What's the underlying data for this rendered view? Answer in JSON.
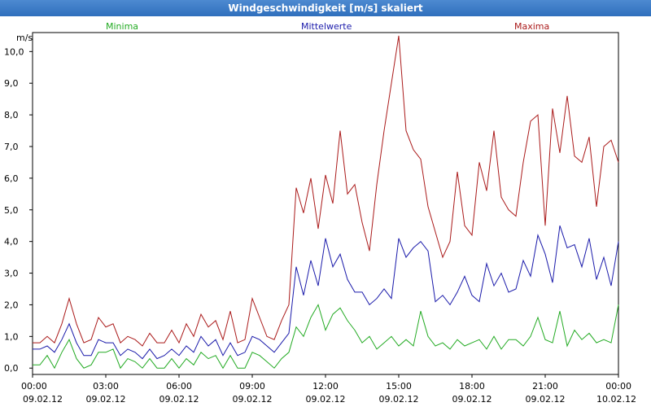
{
  "window": {
    "title": "Windgeschwindigkeit [m/s] skaliert"
  },
  "colors": {
    "minima": "#22aa22",
    "mittelwerte": "#1a1aaa",
    "maxima": "#aa1a1a",
    "grid": "#000000"
  },
  "chart_data": {
    "type": "line",
    "title": "Windgeschwindigkeit [m/s] skaliert",
    "ylabel": "m/s",
    "ylim": [
      -0.2,
      10.6
    ],
    "xlim": [
      0,
      24
    ],
    "grid": true,
    "legend": "top",
    "y_ticks": [
      "0,0",
      "1,0",
      "2,0",
      "3,0",
      "4,0",
      "5,0",
      "6,0",
      "7,0",
      "8,0",
      "9,0",
      "10,0"
    ],
    "x_ticks": [
      {
        "time": "00:00",
        "date": "09.02.12"
      },
      {
        "time": "03:00",
        "date": "09.02.12"
      },
      {
        "time": "06:00",
        "date": "09.02.12"
      },
      {
        "time": "09:00",
        "date": "09.02.12"
      },
      {
        "time": "12:00",
        "date": "09.02.12"
      },
      {
        "time": "15:00",
        "date": "09.02.12"
      },
      {
        "time": "18:00",
        "date": "09.02.12"
      },
      {
        "time": "21:00",
        "date": "09.02.12"
      },
      {
        "time": "00:00",
        "date": "10.02.12"
      }
    ],
    "series": [
      {
        "name": "Minima",
        "x": [
          0,
          0.3,
          0.6,
          0.9,
          1.2,
          1.5,
          1.8,
          2.1,
          2.4,
          2.7,
          3.0,
          3.3,
          3.6,
          3.9,
          4.2,
          4.5,
          4.8,
          5.1,
          5.4,
          5.7,
          6.0,
          6.3,
          6.6,
          6.9,
          7.2,
          7.5,
          7.8,
          8.1,
          8.4,
          8.7,
          9.0,
          9.3,
          9.6,
          9.9,
          10.2,
          10.5,
          10.8,
          11.1,
          11.4,
          11.7,
          12.0,
          12.3,
          12.6,
          12.9,
          13.2,
          13.5,
          13.8,
          14.1,
          14.4,
          14.7,
          15.0,
          15.3,
          15.6,
          15.9,
          16.2,
          16.5,
          16.8,
          17.1,
          17.4,
          17.7,
          18.0,
          18.3,
          18.6,
          18.9,
          19.2,
          19.5,
          19.8,
          20.1,
          20.4,
          20.7,
          21.0,
          21.3,
          21.6,
          21.9,
          22.2,
          22.5,
          22.8,
          23.1,
          23.4,
          23.7,
          24.0
        ],
        "values": [
          0.1,
          0.1,
          0.4,
          0.0,
          0.5,
          0.9,
          0.3,
          0.0,
          0.1,
          0.5,
          0.5,
          0.6,
          0.0,
          0.3,
          0.2,
          0.0,
          0.3,
          0.0,
          0.0,
          0.3,
          0.0,
          0.3,
          0.1,
          0.5,
          0.3,
          0.4,
          0.0,
          0.4,
          0.0,
          0.0,
          0.5,
          0.4,
          0.2,
          0.0,
          0.3,
          0.5,
          1.3,
          1.0,
          1.6,
          2.0,
          1.2,
          1.7,
          1.9,
          1.5,
          1.2,
          0.8,
          1.0,
          0.6,
          0.8,
          1.0,
          0.7,
          0.9,
          0.7,
          1.8,
          1.0,
          0.7,
          0.8,
          0.6,
          0.9,
          0.7,
          0.8,
          0.9,
          0.6,
          1.0,
          0.6,
          0.9,
          0.9,
          0.7,
          1.0,
          1.6,
          0.9,
          0.8,
          1.8,
          0.7,
          1.2,
          0.9,
          1.1,
          0.8,
          0.9,
          0.8,
          2.0
        ]
      },
      {
        "name": "Mittelwerte",
        "x": [
          0,
          0.3,
          0.6,
          0.9,
          1.2,
          1.5,
          1.8,
          2.1,
          2.4,
          2.7,
          3.0,
          3.3,
          3.6,
          3.9,
          4.2,
          4.5,
          4.8,
          5.1,
          5.4,
          5.7,
          6.0,
          6.3,
          6.6,
          6.9,
          7.2,
          7.5,
          7.8,
          8.1,
          8.4,
          8.7,
          9.0,
          9.3,
          9.6,
          9.9,
          10.2,
          10.5,
          10.8,
          11.1,
          11.4,
          11.7,
          12.0,
          12.3,
          12.6,
          12.9,
          13.2,
          13.5,
          13.8,
          14.1,
          14.4,
          14.7,
          15.0,
          15.3,
          15.6,
          15.9,
          16.2,
          16.5,
          16.8,
          17.1,
          17.4,
          17.7,
          18.0,
          18.3,
          18.6,
          18.9,
          19.2,
          19.5,
          19.8,
          20.1,
          20.4,
          20.7,
          21.0,
          21.3,
          21.6,
          21.9,
          22.2,
          22.5,
          22.8,
          23.1,
          23.4,
          23.7,
          24.0
        ],
        "values": [
          0.6,
          0.6,
          0.7,
          0.5,
          0.9,
          1.4,
          0.8,
          0.4,
          0.4,
          0.9,
          0.8,
          0.8,
          0.4,
          0.6,
          0.5,
          0.3,
          0.6,
          0.3,
          0.4,
          0.6,
          0.4,
          0.7,
          0.5,
          1.0,
          0.7,
          0.9,
          0.4,
          0.8,
          0.4,
          0.5,
          1.0,
          0.9,
          0.7,
          0.5,
          0.8,
          1.1,
          3.2,
          2.3,
          3.4,
          2.6,
          4.1,
          3.2,
          3.6,
          2.8,
          2.4,
          2.4,
          2.0,
          2.2,
          2.5,
          2.2,
          4.1,
          3.5,
          3.8,
          4.0,
          3.7,
          2.1,
          2.3,
          2.0,
          2.4,
          2.9,
          2.3,
          2.1,
          3.3,
          2.6,
          3.0,
          2.4,
          2.5,
          3.4,
          2.9,
          4.2,
          3.6,
          2.7,
          4.5,
          3.8,
          3.9,
          3.2,
          4.1,
          2.8,
          3.5,
          2.6,
          4.0
        ]
      },
      {
        "name": "Maxima",
        "x": [
          0,
          0.3,
          0.6,
          0.9,
          1.2,
          1.5,
          1.8,
          2.1,
          2.4,
          2.7,
          3.0,
          3.3,
          3.6,
          3.9,
          4.2,
          4.5,
          4.8,
          5.1,
          5.4,
          5.7,
          6.0,
          6.3,
          6.6,
          6.9,
          7.2,
          7.5,
          7.8,
          8.1,
          8.4,
          8.7,
          9.0,
          9.3,
          9.6,
          9.9,
          10.2,
          10.5,
          10.8,
          11.1,
          11.4,
          11.7,
          12.0,
          12.3,
          12.6,
          12.9,
          13.2,
          13.5,
          13.8,
          14.1,
          14.4,
          14.7,
          15.0,
          15.3,
          15.6,
          15.9,
          16.2,
          16.5,
          16.8,
          17.1,
          17.4,
          17.7,
          18.0,
          18.3,
          18.6,
          18.9,
          19.2,
          19.5,
          19.8,
          20.1,
          20.4,
          20.7,
          21.0,
          21.3,
          21.6,
          21.9,
          22.2,
          22.5,
          22.8,
          23.1,
          23.4,
          23.7,
          24.0
        ],
        "values": [
          0.8,
          0.8,
          1.0,
          0.8,
          1.4,
          2.2,
          1.4,
          0.8,
          0.9,
          1.6,
          1.3,
          1.4,
          0.8,
          1.0,
          0.9,
          0.7,
          1.1,
          0.8,
          0.8,
          1.2,
          0.8,
          1.4,
          1.0,
          1.7,
          1.3,
          1.5,
          0.9,
          1.8,
          0.8,
          0.9,
          2.2,
          1.6,
          1.0,
          0.9,
          1.5,
          2.0,
          5.7,
          4.9,
          6.0,
          4.4,
          6.1,
          5.2,
          7.5,
          5.5,
          5.8,
          4.6,
          3.7,
          5.8,
          7.5,
          9.0,
          10.5,
          7.5,
          6.9,
          6.6,
          5.1,
          4.3,
          3.5,
          4.0,
          6.2,
          4.5,
          4.2,
          6.5,
          5.6,
          7.5,
          5.4,
          5.0,
          4.8,
          6.5,
          7.8,
          8.0,
          4.5,
          8.2,
          6.8,
          8.6,
          6.7,
          6.5,
          7.3,
          5.1,
          7.0,
          7.2,
          6.5
        ]
      }
    ]
  }
}
